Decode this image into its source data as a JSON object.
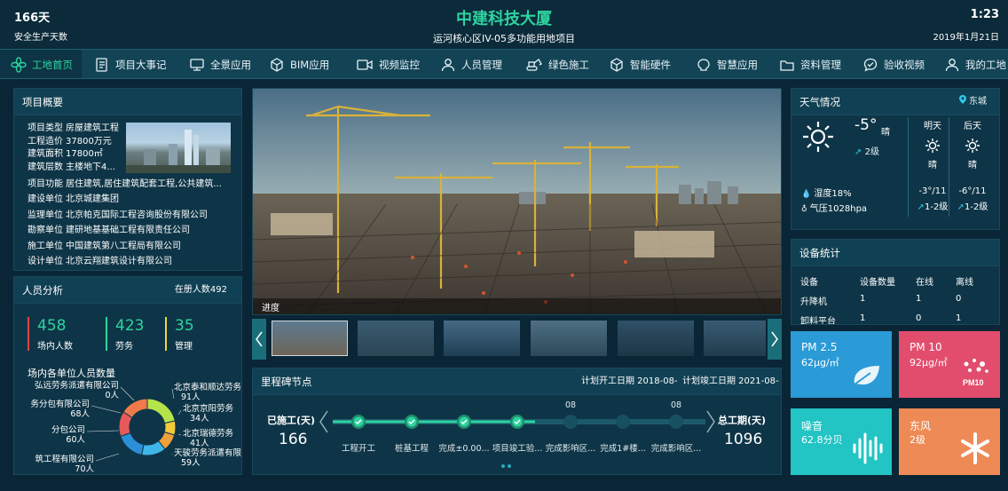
{
  "header": {
    "days": "166天",
    "days_label": "安全生产天数",
    "title": "中建科技大厦",
    "subtitle": "运河核心区IV-05多功能用地项目",
    "time": "1:23",
    "date": "2019年1月21日"
  },
  "nav": [
    {
      "label": "工地首页",
      "icon": "flower-icon",
      "active": true
    },
    {
      "label": "项目大事记",
      "icon": "notebook-icon"
    },
    {
      "label": "全景应用",
      "icon": "monitor-icon"
    },
    {
      "label": "BIM应用",
      "icon": "cube-icon"
    },
    {
      "label": "视频监控",
      "icon": "camera-icon"
    },
    {
      "label": "人员管理",
      "icon": "people-icon"
    },
    {
      "label": "绿色施工",
      "icon": "excavator-icon"
    },
    {
      "label": "智能硬件",
      "icon": "hardware-cube-icon"
    },
    {
      "label": "智慧应用",
      "icon": "brain-icon"
    },
    {
      "label": "资料管理",
      "icon": "folder-icon"
    },
    {
      "label": "验收视频",
      "icon": "chat-check-icon"
    },
    {
      "label": "我的工地",
      "icon": "user-icon"
    }
  ],
  "overview": {
    "title": "项目概要",
    "rows_top": [
      [
        "项目类型",
        "房屋建筑工程"
      ],
      [
        "工程造价",
        "37800万元"
      ],
      [
        "建筑面积",
        "17800㎡"
      ],
      [
        "建筑层数",
        "主楼地下4..."
      ]
    ],
    "rows": [
      [
        "项目功能",
        "居住建筑,居住建筑配套工程,公共建筑..."
      ],
      [
        "建设单位",
        "北京城建集团"
      ],
      [
        "监理单位",
        "北京帕克国际工程咨询股份有限公司"
      ],
      [
        "勘察单位",
        "建研地基基础工程有限责任公司"
      ],
      [
        "施工单位",
        "中国建筑第八工程局有限公司"
      ],
      [
        "设计单位",
        "北京云翔建筑设计有限公司"
      ]
    ]
  },
  "personnel": {
    "title": "人员分析",
    "registered": "在册人数492",
    "stats": [
      {
        "value": "458",
        "label": "场内人数",
        "color": "#e04444"
      },
      {
        "value": "423",
        "label": "劳务",
        "color": "#2ed3a0"
      },
      {
        "value": "35",
        "label": "管理",
        "color": "#e8d83a"
      }
    ],
    "chart_title": "场内各单位人员数量"
  },
  "chart_data": {
    "type": "pie",
    "title": "场内各单位人员数量",
    "segments": [
      {
        "label": "北京泰和顺达劳务",
        "value": 91,
        "value_label": "91人",
        "color": "#b7e34a"
      },
      {
        "label": "北京京阳劳务",
        "value": 34,
        "value_label": "34人",
        "color": "#f2c93a"
      },
      {
        "label": "北京瑞德劳务",
        "value": 41,
        "value_label": "41人",
        "color": "#f0a03a"
      },
      {
        "label": "天骏劳务派遣有限",
        "value": 59,
        "value_label": "59人",
        "color": "#3fb6e8"
      },
      {
        "label": "筑工程有限公司",
        "value": 70,
        "value_label": "70人",
        "color": "#2a8fd6"
      },
      {
        "label": "分包公司",
        "value": 60,
        "value_label": "60人",
        "color": "#e85a5a"
      },
      {
        "label": "务分包有限公司",
        "value": 68,
        "value_label": "68人",
        "color": "#f07a4a"
      },
      {
        "label": "弘远劳务派遣有限公司",
        "value": 0,
        "value_label": "0人",
        "color": "#6fd6c0"
      }
    ]
  },
  "video": {
    "caption": "进度"
  },
  "milestones": {
    "title": "里程碑节点",
    "plan_start": "计划开工日期 2018-08-",
    "plan_end": "计划竣工日期 2021-08-",
    "left_label": "已施工(天)",
    "left_value": "166",
    "right_label": "总工期(天)",
    "right_value": "1096",
    "items": [
      {
        "label": "工程开工",
        "done": true,
        "top": ""
      },
      {
        "label": "桩基工程",
        "done": true,
        "top": ""
      },
      {
        "label": "完成±0.00...",
        "done": true,
        "top": ""
      },
      {
        "label": "项目竣工验...",
        "done": true,
        "top": ""
      },
      {
        "label": "完成影响区...",
        "done": false,
        "top": "08"
      },
      {
        "label": "完成1#楼...",
        "done": false,
        "top": ""
      },
      {
        "label": "完成影响区...",
        "done": false,
        "top": "08"
      }
    ]
  },
  "weather": {
    "title": "天气情况",
    "location": "东城",
    "temp": "-5°",
    "cond": "晴",
    "wind": "2级",
    "humidity": "湿度18%",
    "pressure": "气压1028hpa",
    "forecast": [
      {
        "day": "明天",
        "cond": "晴",
        "temp": "-3°/11",
        "wind": "1-2级"
      },
      {
        "day": "后天",
        "cond": "晴",
        "temp": "-6°/11",
        "wind": "1-2级"
      }
    ]
  },
  "devices": {
    "title": "设备统计",
    "headers": [
      "设备",
      "设备数量",
      "在线",
      "离线"
    ],
    "rows": [
      [
        "升降机",
        "1",
        "1",
        "0"
      ],
      [
        "卸料平台",
        "1",
        "0",
        "1"
      ]
    ]
  },
  "env": [
    {
      "name": "PM 2.5",
      "value": "62μg/㎡",
      "icon": "leaf-icon",
      "color": "#2a9bd6"
    },
    {
      "name": "PM 10",
      "value": "92μg/㎡",
      "icon": "pm10-icon",
      "color": "#e24d6e"
    },
    {
      "name": "噪音",
      "value": "62.8分贝",
      "icon": "soundwave-icon",
      "color": "#22c4c4"
    },
    {
      "name": "东风",
      "value": "2级",
      "icon": "wind-icon",
      "color": "#ee8a55"
    }
  ]
}
